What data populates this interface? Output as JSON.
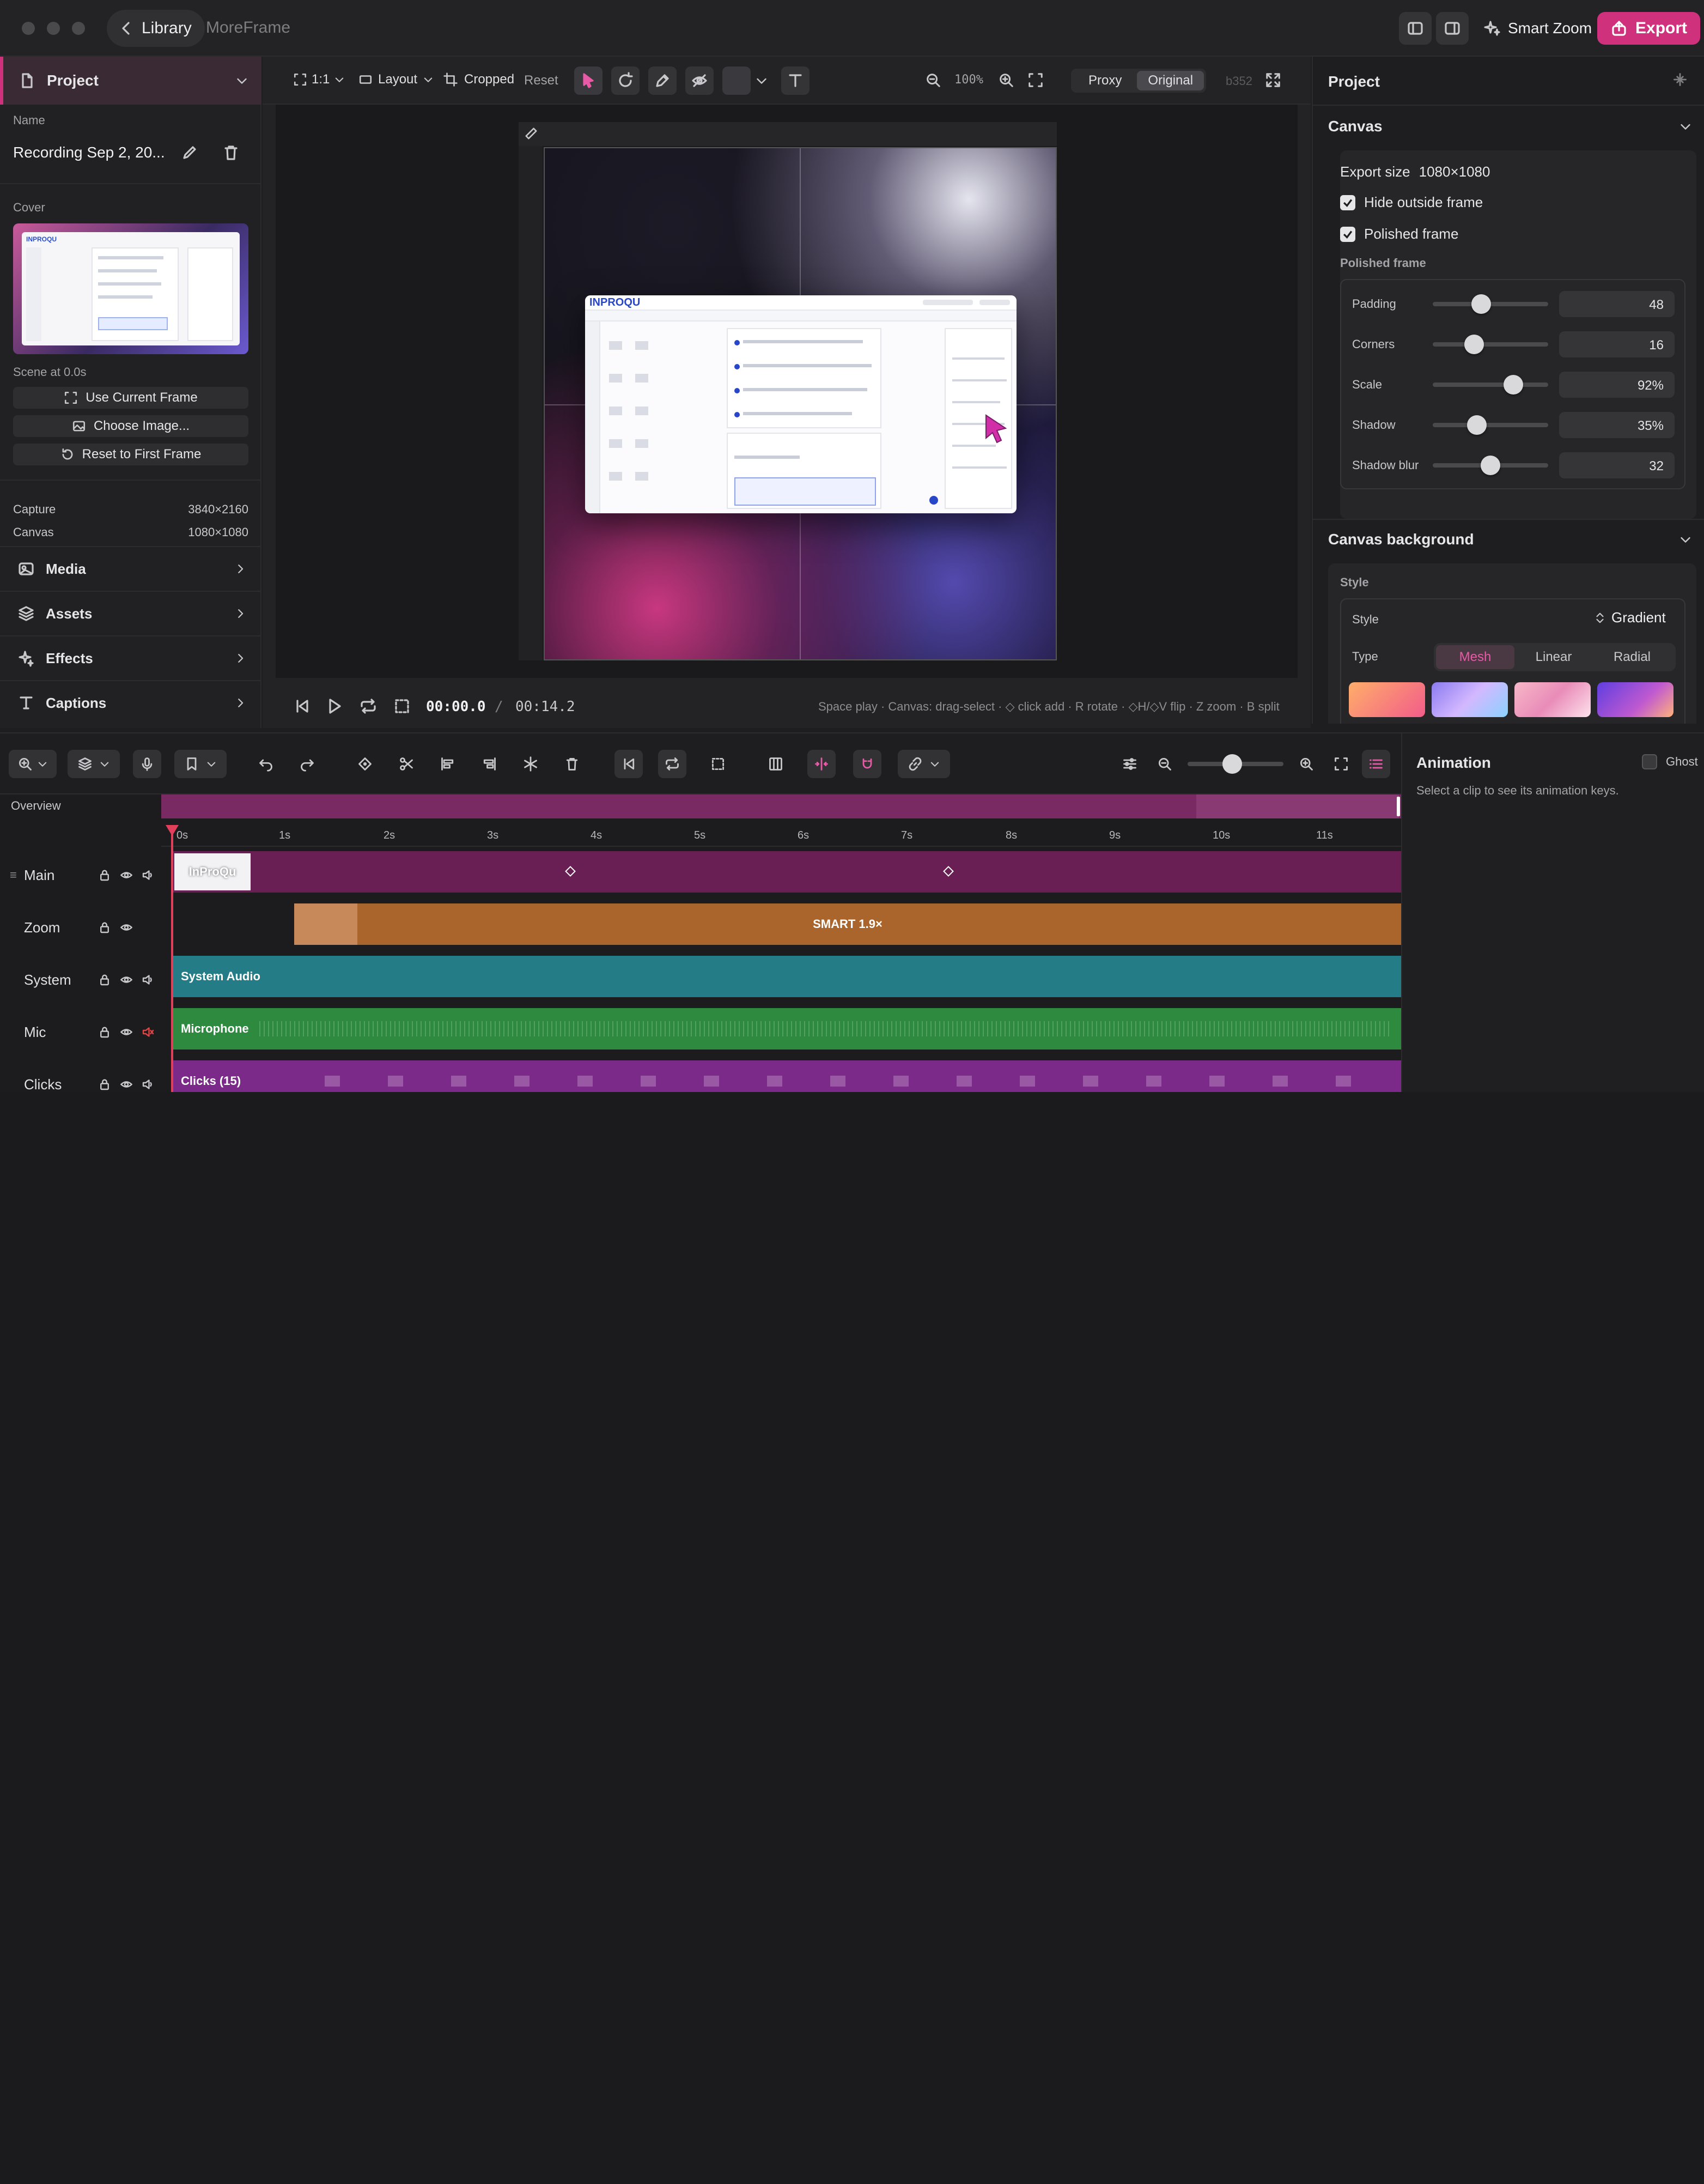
{
  "titlebar": {
    "back_label": "Library",
    "app_name": "MoreFrame",
    "smart_zoom_label": "Smart Zoom",
    "export_label": "Export"
  },
  "left": {
    "section_title": "Project",
    "name_label": "Name",
    "name_value": "Recording Sep 2, 20...",
    "cover_label": "Cover",
    "scene_text": "Scene at 0.0s",
    "use_current_frame": "Use Current Frame",
    "choose_image": "Choose Image...",
    "reset_first_frame": "Reset to First Frame",
    "capture_label": "Capture",
    "capture_value": "3840×2160",
    "canvas_label": "Canvas",
    "canvas_value": "1080×1080",
    "sections": [
      "Media",
      "Assets",
      "Effects",
      "Captions"
    ]
  },
  "toolbar": {
    "ratio": "1:1",
    "layout": "Layout",
    "cropped": "Cropped",
    "reset": "Reset",
    "zoom": "100%",
    "proxy": "Proxy",
    "original": "Original",
    "build": "b352"
  },
  "playbar": {
    "current": "00:00.0",
    "separator": "/",
    "total": "00:14.2",
    "hint": "Space play · Canvas: drag-select · ◇ click add · R rotate · ◇H/◇V flip · Z zoom · B split"
  },
  "right": {
    "title": "Project",
    "canvas_title": "Canvas",
    "export_size_label": "Export size",
    "export_size_value": "1080×1080",
    "hide_outside": "Hide outside frame",
    "polished_frame": "Polished frame",
    "polished_frame_label": "Polished frame",
    "sliders": [
      {
        "name": "Padding",
        "value": "48",
        "fraction": 0.42
      },
      {
        "name": "Corners",
        "value": "16",
        "fraction": 0.36
      },
      {
        "name": "Scale",
        "value": "92%",
        "fraction": 0.7
      },
      {
        "name": "Shadow",
        "value": "35%",
        "fraction": 0.38
      },
      {
        "name": "Shadow blur",
        "value": "32",
        "fraction": 0.5
      }
    ],
    "bg_title": "Canvas background",
    "style_label": "Style",
    "style_row_label": "Style",
    "style_value": "Gradient",
    "type_label": "Type",
    "types": [
      "Mesh",
      "Linear",
      "Radial"
    ],
    "swatches": [
      "#ff9a6a",
      "#9f8af0",
      "#f4a9c8",
      "#7d5ae0"
    ]
  },
  "timeline": {
    "overview_label": "Overview",
    "ticks": [
      "0s",
      "1s",
      "2s",
      "3s",
      "4s",
      "5s",
      "6s",
      "7s",
      "8s",
      "9s",
      "10s",
      "11s"
    ],
    "tracks": [
      {
        "name": "Main",
        "clip": "InProQu"
      },
      {
        "name": "Zoom",
        "clip": "SMART 1.9×"
      },
      {
        "name": "System",
        "clip": "System Audio"
      },
      {
        "name": "Mic",
        "clip": "Microphone"
      },
      {
        "name": "Clicks",
        "clip": "Clicks (15)"
      }
    ]
  },
  "animation": {
    "title": "Animation",
    "ghost_label": "Ghost",
    "hint": "Select a clip to see its animation keys."
  },
  "screenshot": {
    "brand": "INPROQU"
  },
  "colors": {
    "accent": "#d0317c",
    "main_clip": "#6a1f54",
    "zoom_clip": "#a9652c",
    "system_clip": "#247d86",
    "mic_clip": "#2d8a3e",
    "clicks_clip": "#7c2a8a"
  }
}
